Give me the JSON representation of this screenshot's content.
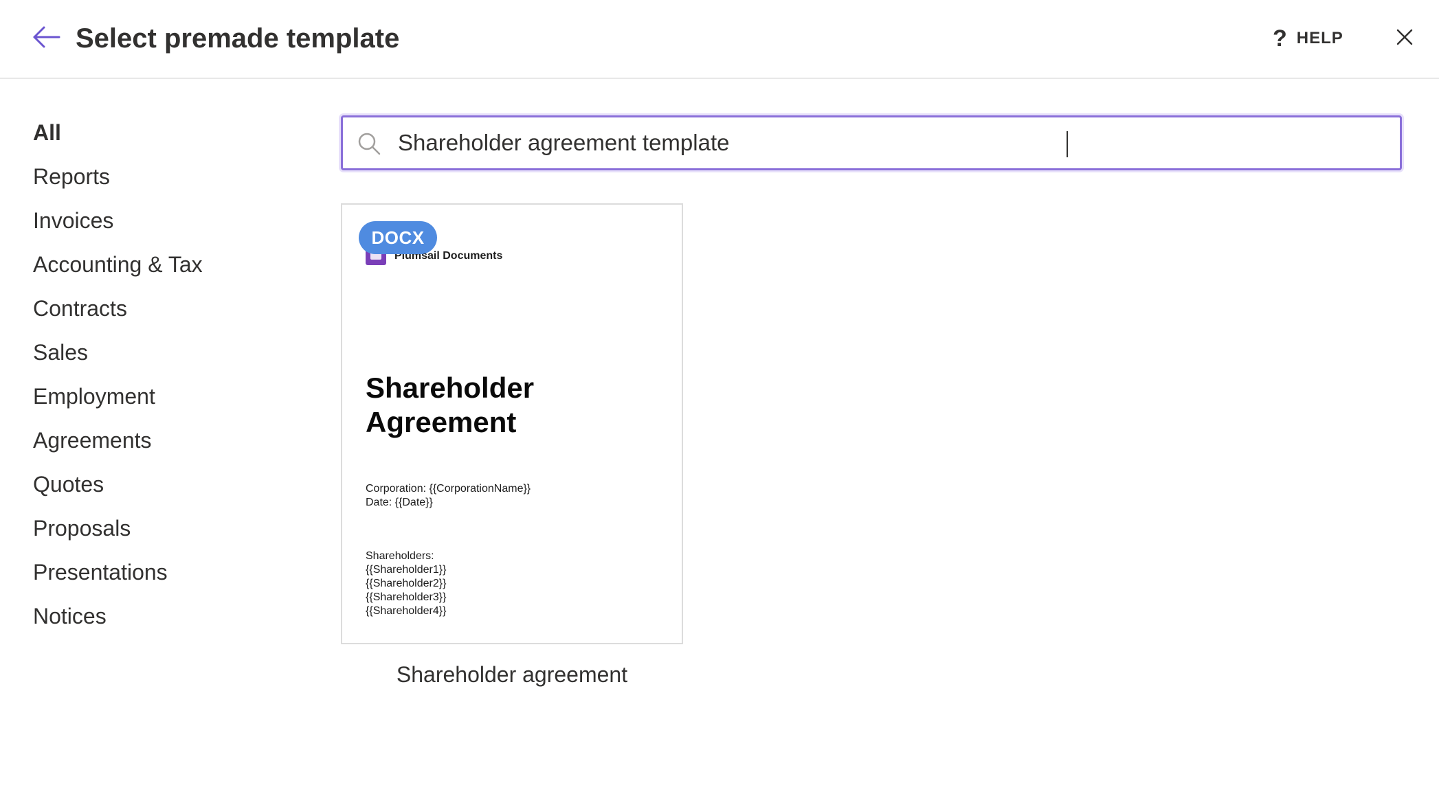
{
  "header": {
    "title": "Select premade template",
    "help_icon": "?",
    "help_label": "HELP"
  },
  "sidebar": {
    "items": [
      {
        "label": "All",
        "active": true
      },
      {
        "label": "Reports"
      },
      {
        "label": "Invoices"
      },
      {
        "label": "Accounting & Tax"
      },
      {
        "label": "Contracts"
      },
      {
        "label": "Sales"
      },
      {
        "label": "Employment"
      },
      {
        "label": "Agreements"
      },
      {
        "label": "Quotes"
      },
      {
        "label": "Proposals"
      },
      {
        "label": "Presentations"
      },
      {
        "label": "Notices"
      }
    ]
  },
  "search": {
    "value": "Shareholder agreement template"
  },
  "results": [
    {
      "badge": "DOCX",
      "preview": {
        "brand": "Plumsail Documents",
        "title_line1": "Shareholder",
        "title_line2": "Agreement",
        "corporation": "Corporation: {{CorporationName}}",
        "date": "Date: {{Date}}",
        "shareholders_label": "Shareholders:",
        "shareholders": [
          "{{Shareholder1}}",
          "{{Shareholder2}}",
          "{{Shareholder3}}",
          "{{Shareholder4}}"
        ]
      },
      "name": "Shareholder agreement"
    }
  ],
  "colors": {
    "accent": "#8a6fd9",
    "badge": "#4f8be0",
    "text": "#323130"
  }
}
